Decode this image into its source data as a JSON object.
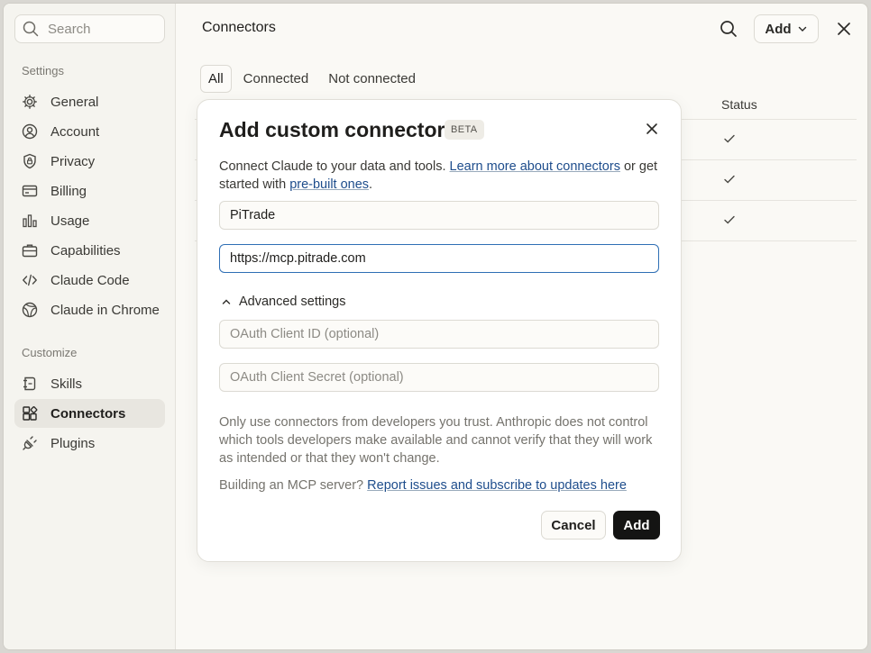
{
  "sidebar": {
    "search_placeholder": "Search",
    "settings_label": "Settings",
    "settings_items": [
      {
        "label": "General",
        "icon": "gear-icon"
      },
      {
        "label": "Account",
        "icon": "account-icon"
      },
      {
        "label": "Privacy",
        "icon": "shield-icon"
      },
      {
        "label": "Billing",
        "icon": "billing-icon"
      },
      {
        "label": "Usage",
        "icon": "usage-icon"
      },
      {
        "label": "Capabilities",
        "icon": "briefcase-icon"
      },
      {
        "label": "Claude Code",
        "icon": "code-icon"
      },
      {
        "label": "Claude in Chrome",
        "icon": "globe-icon"
      }
    ],
    "customize_label": "Customize",
    "customize_items": [
      {
        "label": "Skills",
        "icon": "skills-icon"
      },
      {
        "label": "Connectors",
        "icon": "connectors-icon",
        "active": true
      },
      {
        "label": "Plugins",
        "icon": "plugin-icon"
      }
    ]
  },
  "header": {
    "title": "Connectors",
    "add_label": "Add"
  },
  "tabs": [
    {
      "label": "All",
      "active": true
    },
    {
      "label": "Connected"
    },
    {
      "label": "Not connected"
    }
  ],
  "table": {
    "status_header": "Status"
  },
  "modal": {
    "title": "Add custom connector",
    "badge": "BETA",
    "desc_prefix": "Connect Claude to your data and tools.",
    "desc_link1": "Learn more about connectors",
    "desc_mid": "or get started with",
    "desc_link2": "pre-built ones",
    "desc_suffix": ".",
    "name_value": "PiTrade",
    "url_value": "https://mcp.pitrade.com",
    "advanced_label": "Advanced settings",
    "client_id_placeholder": "OAuth Client ID (optional)",
    "client_secret_placeholder": "OAuth Client Secret (optional)",
    "warning": "Only use connectors from developers you trust. Anthropic does not control which tools developers make available and cannot verify that they will work as intended or that they won't change.",
    "build_prefix": "Building an MCP server?",
    "build_link": "Report issues and subscribe to updates here",
    "cancel_label": "Cancel",
    "add_label": "Add"
  },
  "colors": {
    "accent_link": "#1e4d8c",
    "primary_button": "#141413",
    "focus_border": "#2f6fb5"
  }
}
